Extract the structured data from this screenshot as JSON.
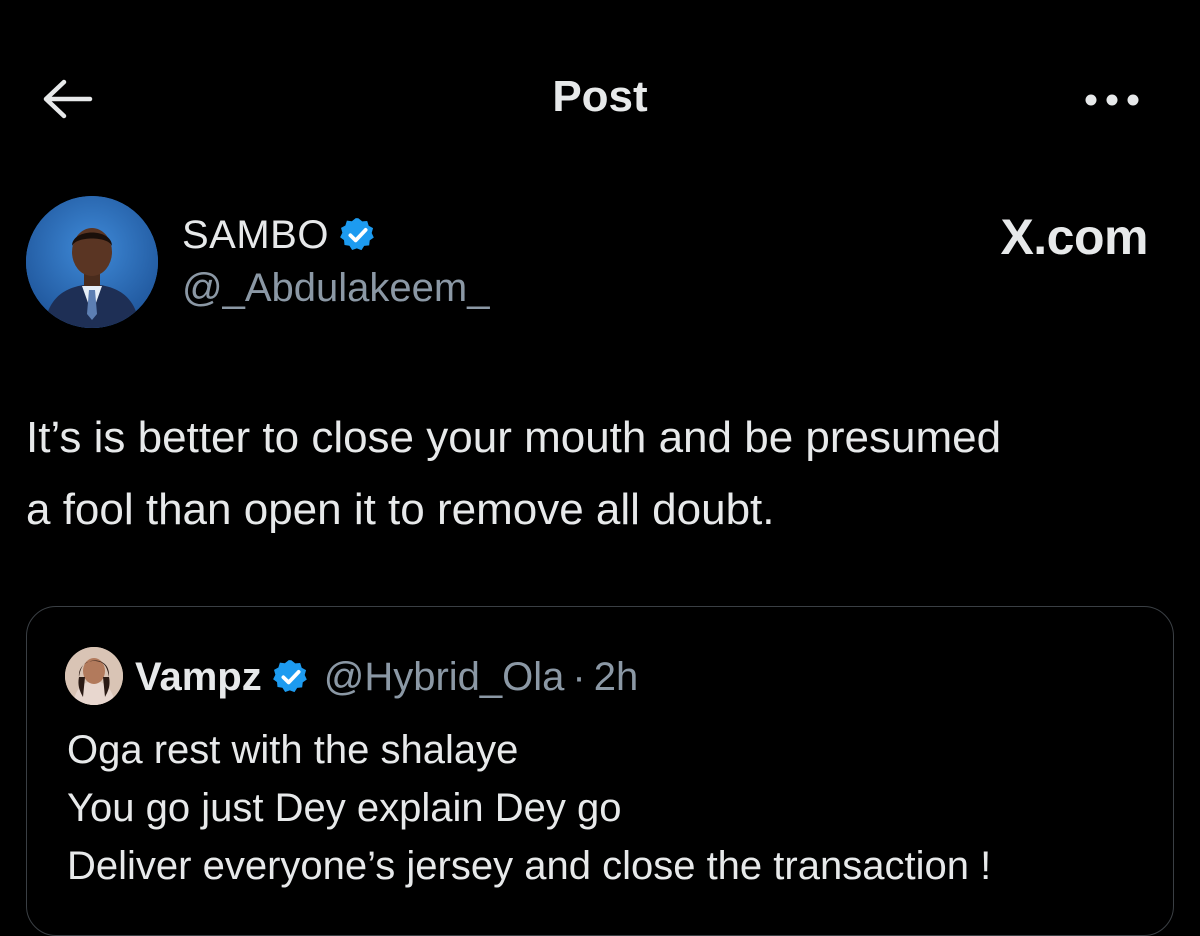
{
  "header": {
    "title": "Post",
    "back_icon": "arrow-left-icon",
    "more_icon": "more-horizontal-icon"
  },
  "post": {
    "author": {
      "name": "SAMBO",
      "handle": "@_Abdulakeem_",
      "verified": true
    },
    "source_label": "X.com",
    "text_lines": [
      "It’s is better to close your mouth and be presumed",
      "a fool than open it to remove all doubt."
    ]
  },
  "quoted_post": {
    "author": {
      "name": "Vampz",
      "handle": "@Hybrid_Ola",
      "verified": true
    },
    "separator": "·",
    "time": "2h",
    "text_lines": [
      "Oga rest with the shalaye",
      "You go just Dey explain Dey go",
      "Deliver everyone’s jersey and close the transaction !"
    ]
  },
  "colors": {
    "background": "#000000",
    "text_primary": "#e7e9ea",
    "text_secondary": "#8b98a5",
    "verified_badge": "#1d9bf0",
    "card_border": "#3a3f44"
  }
}
